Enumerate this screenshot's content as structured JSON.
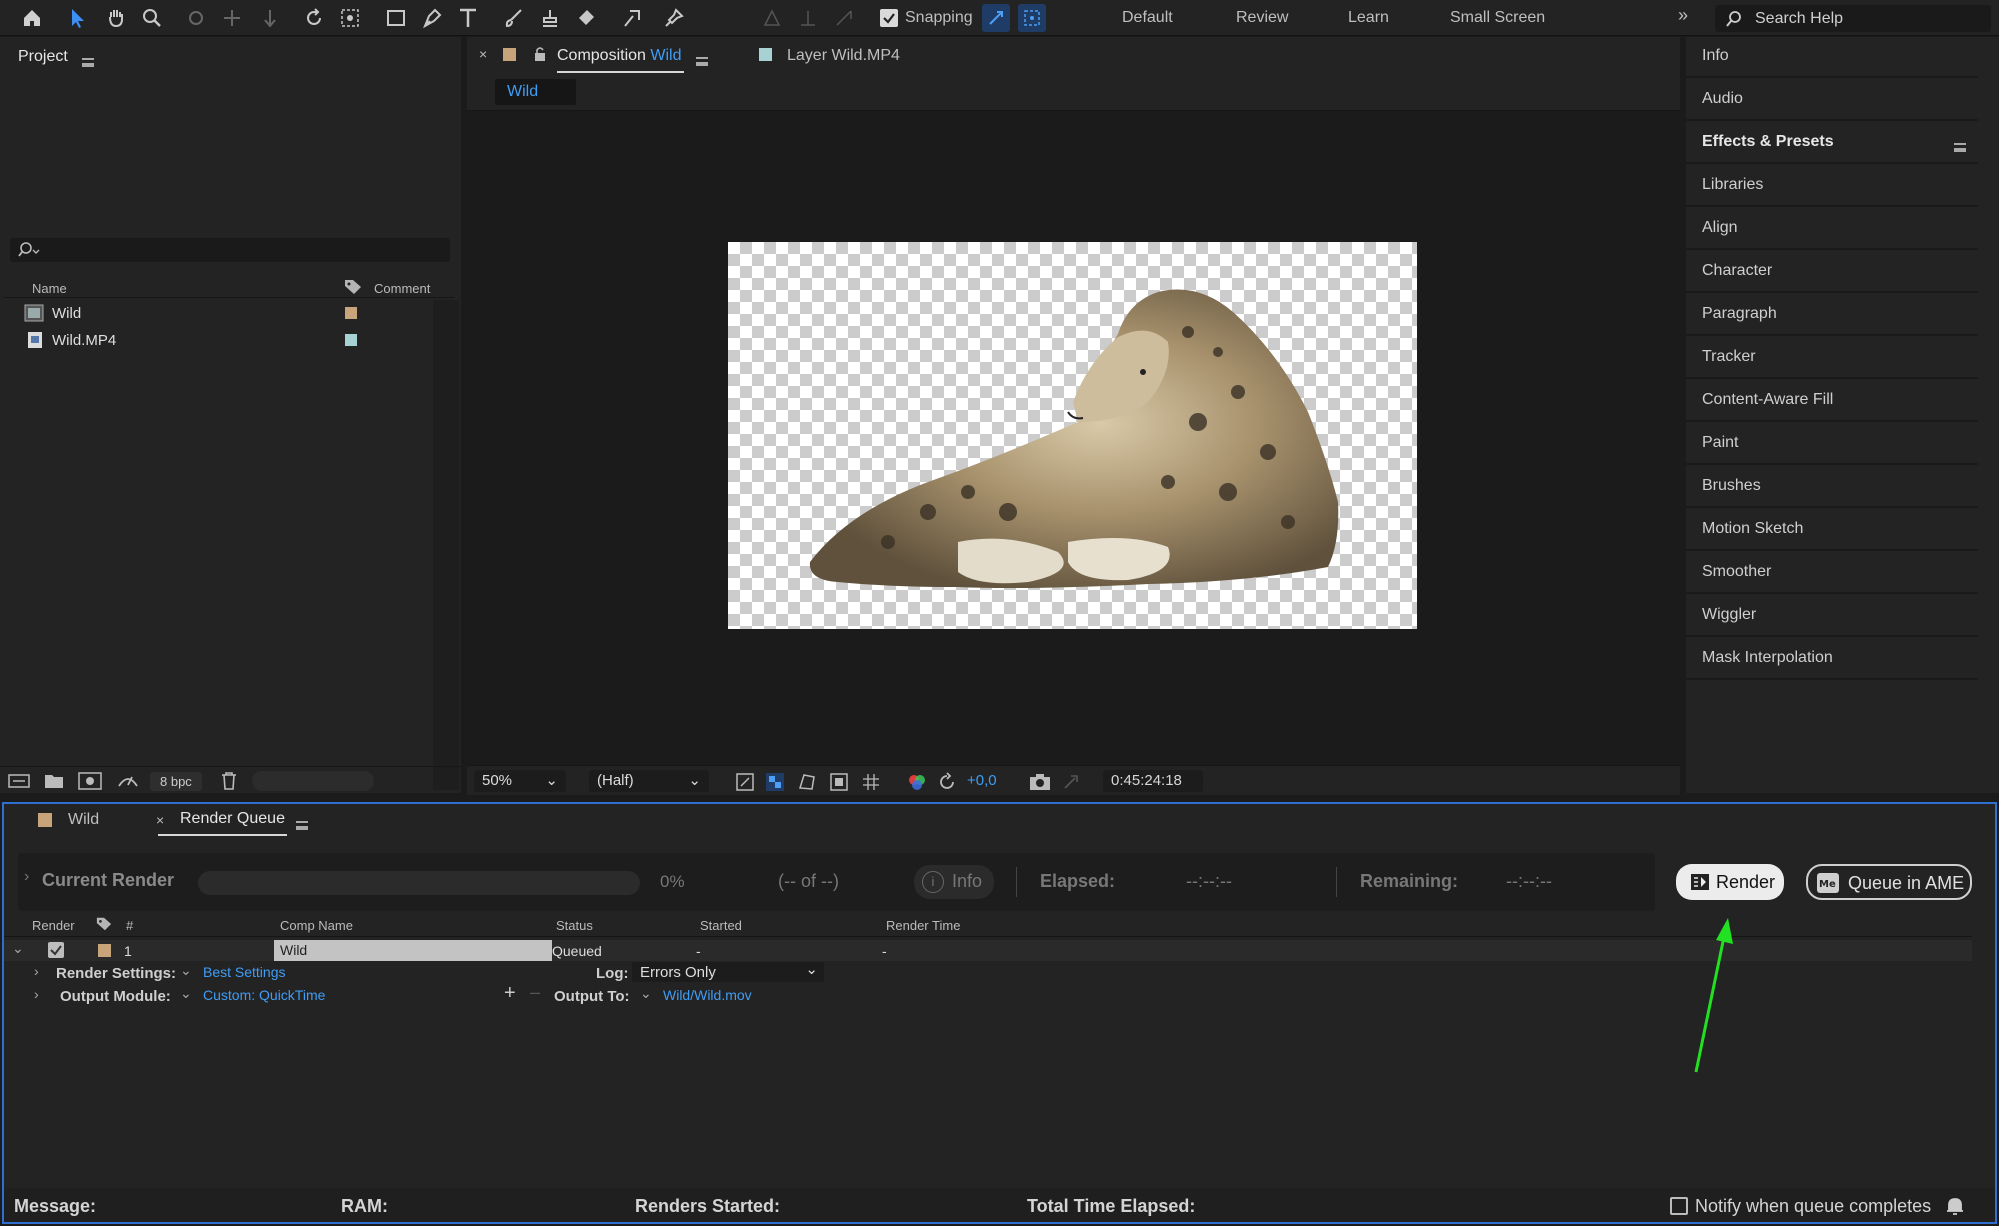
{
  "toolbar": {
    "snapping_label": "Snapping",
    "workspaces": [
      "Default",
      "Review",
      "Learn",
      "Small Screen"
    ],
    "search_placeholder": "Search Help"
  },
  "project": {
    "title": "Project",
    "columns": {
      "name": "Name",
      "comment": "Comment"
    },
    "items": [
      {
        "name": "Wild",
        "type": "composition",
        "color": "#c7a479"
      },
      {
        "name": "Wild.MP4",
        "type": "footage",
        "color": "#a7d1d3"
      }
    ],
    "bpc": "8 bpc"
  },
  "composition": {
    "tab_prefix": "Composition",
    "tab_name": "Wild",
    "layer_tab": "Layer Wild.MP4",
    "breadcrumb": "Wild",
    "zoom": "50%",
    "resolution": "(Half)",
    "exposure": "+0,0",
    "timecode": "0:45:24:18"
  },
  "right_panel": {
    "items": [
      "Info",
      "Audio",
      "Effects & Presets",
      "Libraries",
      "Align",
      "Character",
      "Paragraph",
      "Tracker",
      "Content-Aware Fill",
      "Paint",
      "Brushes",
      "Motion Sketch",
      "Smoother",
      "Wiggler",
      "Mask Interpolation"
    ]
  },
  "render_queue": {
    "tabs": {
      "comp": "Wild",
      "queue": "Render Queue"
    },
    "current_render": "Current Render",
    "progress": "0%",
    "of_text": "(-- of --)",
    "info_btn": "Info",
    "elapsed_label": "Elapsed:",
    "elapsed_value": "--:--:--",
    "remaining_label": "Remaining:",
    "remaining_value": "--:--:--",
    "render_btn": "Render",
    "queue_ame_btn": "Queue in AME",
    "columns": {
      "render": "Render",
      "num": "#",
      "comp_name": "Comp Name",
      "status": "Status",
      "started": "Started",
      "render_time": "Render Time"
    },
    "row": {
      "num": "1",
      "comp_name": "Wild",
      "status": "Queued",
      "started": "-",
      "render_time": "-"
    },
    "render_settings_label": "Render Settings:",
    "render_settings_value": "Best Settings",
    "log_label": "Log:",
    "log_value": "Errors Only",
    "output_module_label": "Output Module:",
    "output_module_value": "Custom: QuickTime",
    "output_to_label": "Output To:",
    "output_to_value": "Wild/Wild.mov",
    "footer": {
      "message": "Message:",
      "ram": "RAM:",
      "renders_started": "Renders Started:",
      "total_time": "Total Time Elapsed:",
      "notify": "Notify when queue completes"
    }
  }
}
